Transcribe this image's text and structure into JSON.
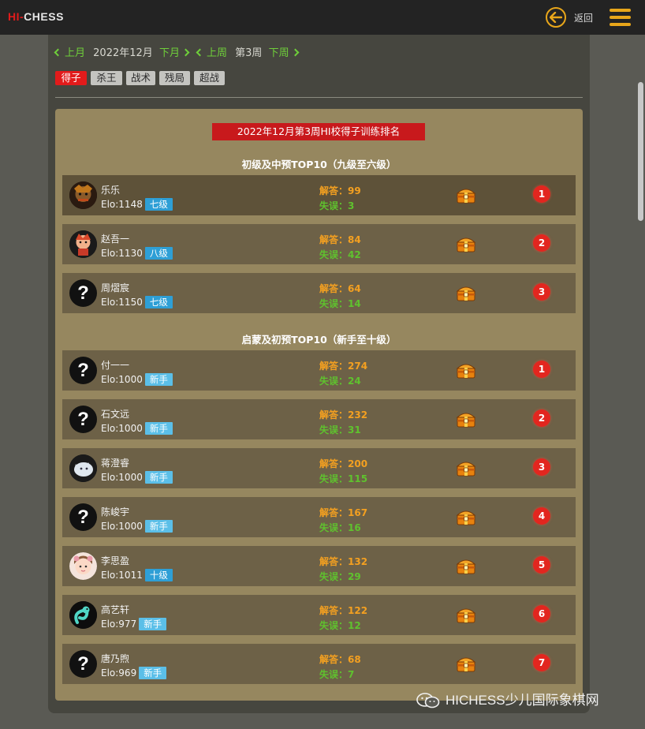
{
  "header": {
    "logo": {
      "hi": "HI",
      "dash": "-",
      "chess": "CHESS"
    },
    "back_label": "返回"
  },
  "nav": {
    "prev_month": "上月",
    "month": "2022年12月",
    "next_month": "下月",
    "prev_week": "上周",
    "week": "第3周",
    "next_week": "下周"
  },
  "tabs": [
    {
      "label": "得子",
      "active": true
    },
    {
      "label": "杀王",
      "active": false
    },
    {
      "label": "战术",
      "active": false
    },
    {
      "label": "残局",
      "active": false
    },
    {
      "label": "超战",
      "active": false
    }
  ],
  "banner": "2022年12月第3周HI校得子训练排名",
  "sections": [
    {
      "title": "初级及中预TOP10（九级至六级）",
      "rows": [
        {
          "name": "乐乐",
          "elo": "Elo:1148",
          "level": "七级",
          "solve": "解答：99",
          "miss": "失误：3",
          "rank": "1",
          "avatar": "portrait"
        },
        {
          "name": "赵吾一",
          "elo": "Elo:1130",
          "level": "八级",
          "solve": "解答：84",
          "miss": "失误：42",
          "rank": "2",
          "avatar": "cartoon"
        },
        {
          "name": "周熠宸",
          "elo": "Elo:1150",
          "level": "七级",
          "solve": "解答：64",
          "miss": "失误：14",
          "rank": "3",
          "avatar": "question"
        }
      ]
    },
    {
      "title": "启蒙及初预TOP10（新手至十级）",
      "rows": [
        {
          "name": "付一一",
          "elo": "Elo:1000",
          "level": "新手",
          "solve": "解答：274",
          "miss": "失误：24",
          "rank": "1",
          "avatar": "question"
        },
        {
          "name": "石文远",
          "elo": "Elo:1000",
          "level": "新手",
          "solve": "解答：232",
          "miss": "失误：31",
          "rank": "2",
          "avatar": "question"
        },
        {
          "name": "蒋澄睿",
          "elo": "Elo:1000",
          "level": "新手",
          "solve": "解答：200",
          "miss": "失误：115",
          "rank": "3",
          "avatar": "creature"
        },
        {
          "name": "陈峻宇",
          "elo": "Elo:1000",
          "level": "新手",
          "solve": "解答：167",
          "miss": "失误：16",
          "rank": "4",
          "avatar": "question"
        },
        {
          "name": "李思盈",
          "elo": "Elo:1011",
          "level": "十级",
          "solve": "解答：132",
          "miss": "失误：29",
          "rank": "5",
          "avatar": "girl"
        },
        {
          "name": "高艺轩",
          "elo": "Elo:977",
          "level": "新手",
          "solve": "解答：122",
          "miss": "失误：12",
          "rank": "6",
          "avatar": "snake"
        },
        {
          "name": "唐乃煦",
          "elo": "Elo:969",
          "level": "新手",
          "solve": "解答：68",
          "miss": "失误：7",
          "rank": "7",
          "avatar": "question"
        }
      ]
    }
  ],
  "avatar_question_mark": "?",
  "watermark": "HICHESS少儿国际象棋网",
  "colors": {
    "accent_red": "#e21b1b",
    "accent_orange": "#e8a61a",
    "green": "#6fcf3a",
    "panel": "#96875f",
    "row": "#6d6147"
  }
}
